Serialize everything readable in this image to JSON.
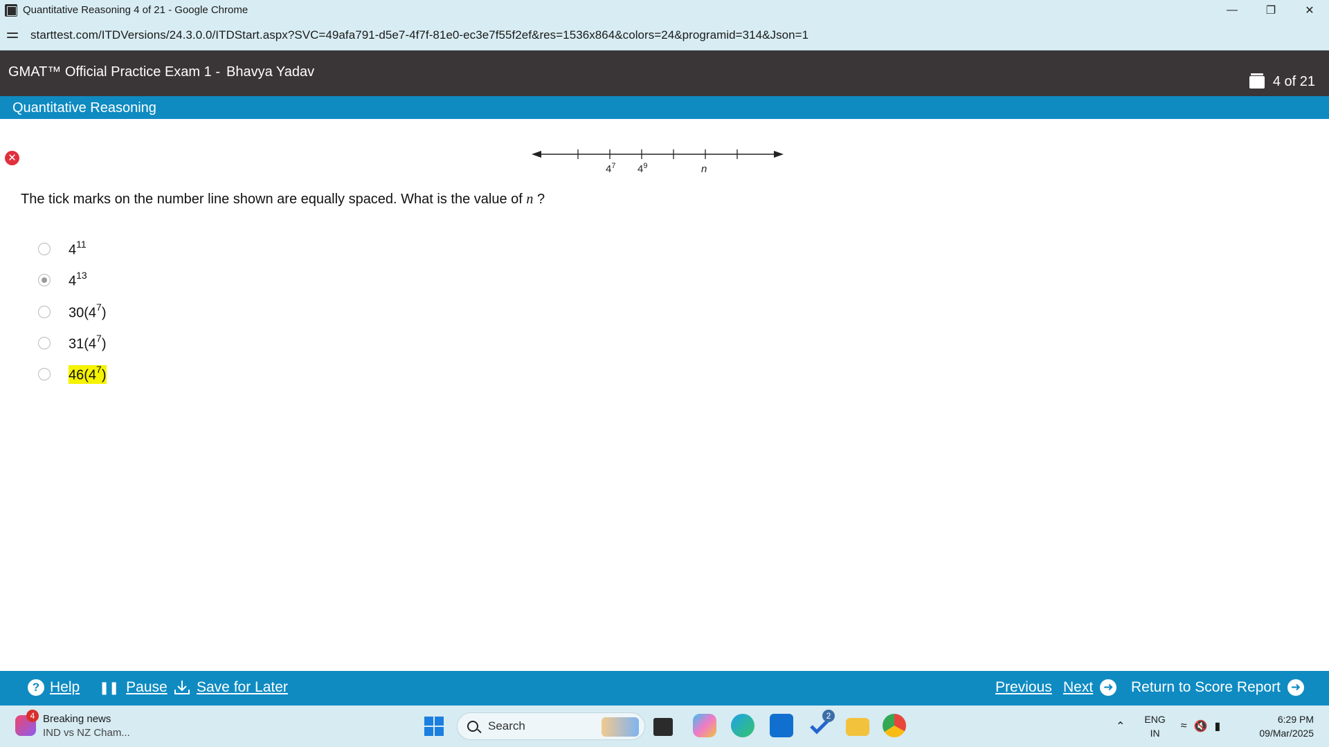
{
  "browser": {
    "window_title": "Quantitative Reasoning 4 of 21 - Google Chrome",
    "url": "starttest.com/ITDVersions/24.3.0.0/ITDStart.aspx?SVC=49afa791-d5e7-4f7f-81e0-ec3e7f55f2ef&res=1536x864&colors=24&programid=314&Json=1"
  },
  "exam": {
    "title": "GMAT™ Official Practice Exam 1 -",
    "user": "Bhavya Yadav",
    "counter": "4 of 21",
    "section": "Quantitative Reasoning"
  },
  "question": {
    "text": "The tick marks on the number line shown are equally spaced. What is the value of",
    "variable": "n",
    "qmark": "?",
    "number_line": {
      "labels": [
        {
          "base": "4",
          "exp": "7"
        },
        {
          "base": "4",
          "exp": "9"
        },
        {
          "base": "n",
          "exp": ""
        }
      ]
    },
    "options": [
      {
        "base": "4",
        "exp": "11",
        "suffix": "",
        "selected": false,
        "highlighted": false
      },
      {
        "base": "4",
        "exp": "13",
        "suffix": "",
        "selected": true,
        "highlighted": false
      },
      {
        "base": "30(4",
        "exp": "7",
        "suffix": ")",
        "selected": false,
        "highlighted": false
      },
      {
        "base": "31(4",
        "exp": "7",
        "suffix": ")",
        "selected": false,
        "highlighted": false
      },
      {
        "base": "46(4",
        "exp": "7",
        "suffix": ")",
        "selected": false,
        "highlighted": true
      }
    ]
  },
  "footer": {
    "help": "Help",
    "pause": "Pause",
    "save": "Save for Later",
    "previous": "Previous",
    "next": "Next",
    "return": "Return to Score Report"
  },
  "taskbar": {
    "news_badge": "4",
    "news_title": "Breaking news",
    "news_sub": "IND vs NZ Cham...",
    "search_label": "Search",
    "outlook_badge": "2",
    "lang_top": "ENG",
    "lang_bottom": "IN",
    "time": "6:29 PM",
    "date": "09/Mar/2025"
  },
  "colors": {
    "header_bg": "#3a3537",
    "section_bg": "#0f8bc2",
    "highlight": "#f5f300",
    "mark_red": "#e0303d"
  }
}
